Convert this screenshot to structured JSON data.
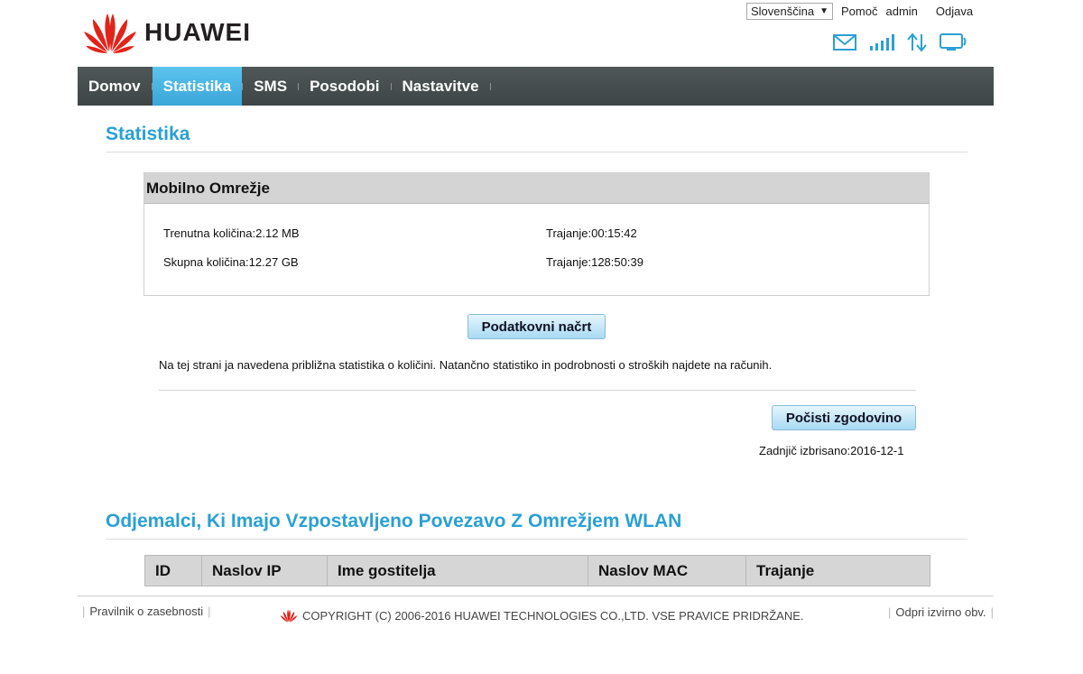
{
  "brand": {
    "name": "HUAWEI",
    "logo_color": "#e2231a"
  },
  "top_bar": {
    "language": "Slovenščina",
    "help": "Pomoč",
    "user": "admin",
    "logout": "Odjava"
  },
  "status_icons": [
    "mail-icon",
    "signal-icon",
    "data-transfer-icon",
    "device-icon"
  ],
  "nav": {
    "items": [
      {
        "label": "Domov",
        "active": false
      },
      {
        "label": "Statistika",
        "active": true
      },
      {
        "label": "SMS",
        "active": false
      },
      {
        "label": "Posodobi",
        "active": false
      },
      {
        "label": "Nastavitve",
        "active": false
      }
    ]
  },
  "statistics": {
    "title": "Statistika",
    "box_title": "Mobilno Omrežje",
    "current_amount": "Trenutna količina:2.12 MB",
    "current_duration": "Trajanje:00:15:42",
    "total_amount": "Skupna količina:12.27 GB",
    "total_duration": "Trajanje:128:50:39",
    "data_plan_button": "Podatkovni načrt",
    "info_text": "Na tej strani ja navedena približna statistika o količini. Natančno statistiko in podrobnosti o stroških najdete na računih.",
    "clear_history_button": "Počisti zgodovino",
    "last_cleared": "Zadnjič izbrisano:2016-12-1"
  },
  "wlan_clients": {
    "title": "Odjemalci, Ki Imajo Vzpostavljeno Povezavo Z Omrežjem WLAN",
    "columns": [
      "ID",
      "Naslov IP",
      "Ime gostitelja",
      "Naslov MAC",
      "Trajanje"
    ]
  },
  "footer": {
    "privacy": "Pravilnik o zasebnosti",
    "copyright": "COPYRIGHT (C) 2006-2016 HUAWEI TECHNOLOGIES CO.,LTD. VSE PRAVICE PRIDRŽANE.",
    "open_source": "Odpri izvirno obv."
  },
  "colors": {
    "accent": "#2aa0d4",
    "nav_bg": "#464e4f",
    "nav_active": "#4ab5e3"
  }
}
